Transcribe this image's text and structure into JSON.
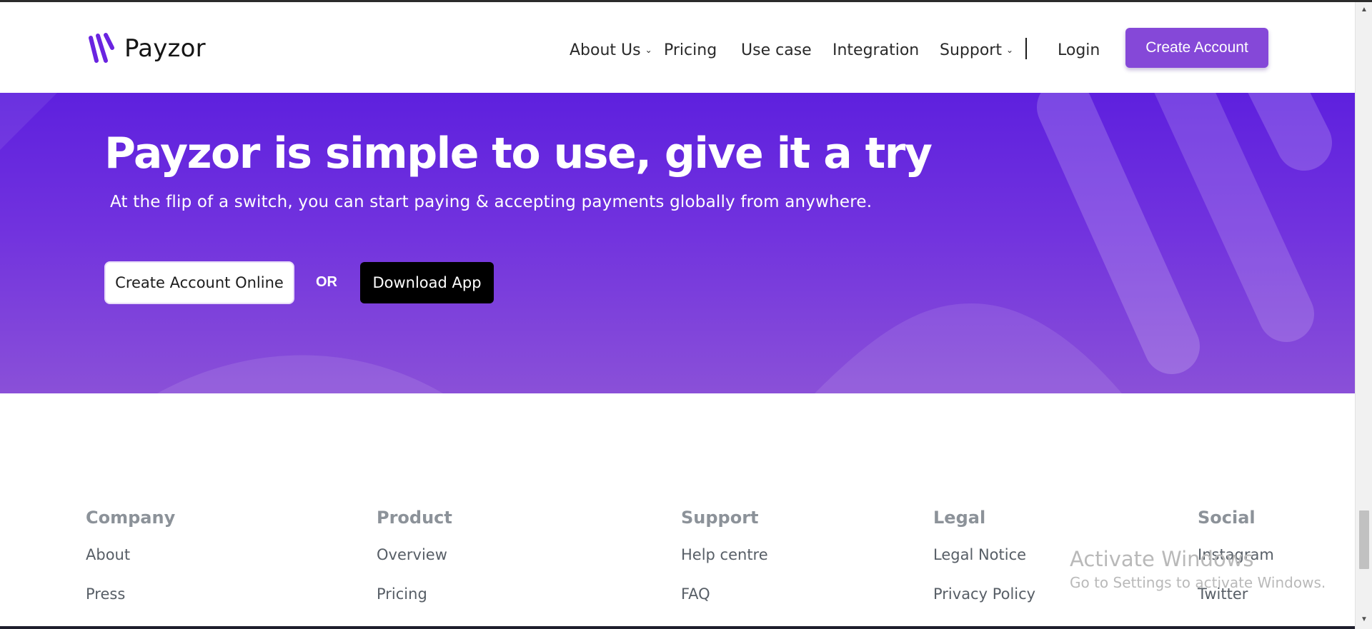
{
  "brand": {
    "name": "Payzor",
    "accent": "#8548d8",
    "logo_color": "#6a24e0"
  },
  "nav": {
    "items": [
      {
        "label": "About Us",
        "has_dropdown": true
      },
      {
        "label": "Pricing",
        "has_dropdown": false
      },
      {
        "label": "Use case",
        "has_dropdown": false
      },
      {
        "label": "Integration",
        "has_dropdown": false
      },
      {
        "label": "Support",
        "has_dropdown": true
      }
    ],
    "login": "Login",
    "create_account": "Create Account",
    "dropdown_icon": "chevron-down-icon"
  },
  "hero": {
    "title": "Payzor is simple to use, give it a try",
    "subtitle": "At the flip of a switch, you can start paying & accepting payments globally from anywhere.",
    "primary_button": "Create Account Online",
    "separator": "OR",
    "secondary_button": "Download App",
    "gradient_top": "#5e20de",
    "gradient_bottom": "#8a50d8"
  },
  "footer": {
    "columns": [
      {
        "heading": "Company",
        "links": [
          "About",
          "Press"
        ]
      },
      {
        "heading": "Product",
        "links": [
          "Overview",
          "Pricing"
        ]
      },
      {
        "heading": "Support",
        "links": [
          "Help centre",
          "FAQ"
        ]
      },
      {
        "heading": "Legal",
        "links": [
          "Legal Notice",
          "Privacy Policy"
        ]
      },
      {
        "heading": "Social",
        "links": [
          "Instagram",
          "Twitter"
        ]
      }
    ]
  },
  "watermark": {
    "line1": "Activate Windows",
    "line2": "Go to Settings to activate Windows."
  }
}
